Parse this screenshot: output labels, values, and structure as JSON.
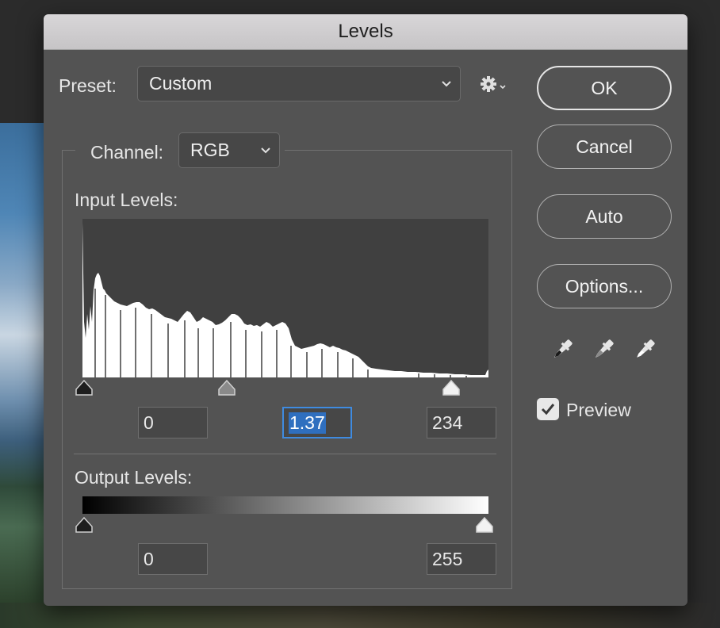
{
  "window": {
    "title": "Levels"
  },
  "preset": {
    "label": "Preset:",
    "value": "Custom"
  },
  "channel": {
    "label": "Channel:",
    "value": "RGB"
  },
  "input_levels": {
    "label": "Input Levels:",
    "black": "0",
    "gamma": "1.37",
    "white": "234"
  },
  "output_levels": {
    "label": "Output Levels:",
    "black": "0",
    "white": "255"
  },
  "buttons": {
    "ok": "OK",
    "cancel": "Cancel",
    "auto": "Auto",
    "options": "Options..."
  },
  "preview": {
    "label": "Preview",
    "checked": true
  },
  "icons": {
    "gear": "gear-icon",
    "black_eyedropper": "eyedropper-black-icon",
    "gray_eyedropper": "eyedropper-gray-icon",
    "white_eyedropper": "eyedropper-white-icon"
  },
  "colors": {
    "dialog_bg": "#535353",
    "histogram_bg": "#404040",
    "focus": "#3f8be0"
  }
}
